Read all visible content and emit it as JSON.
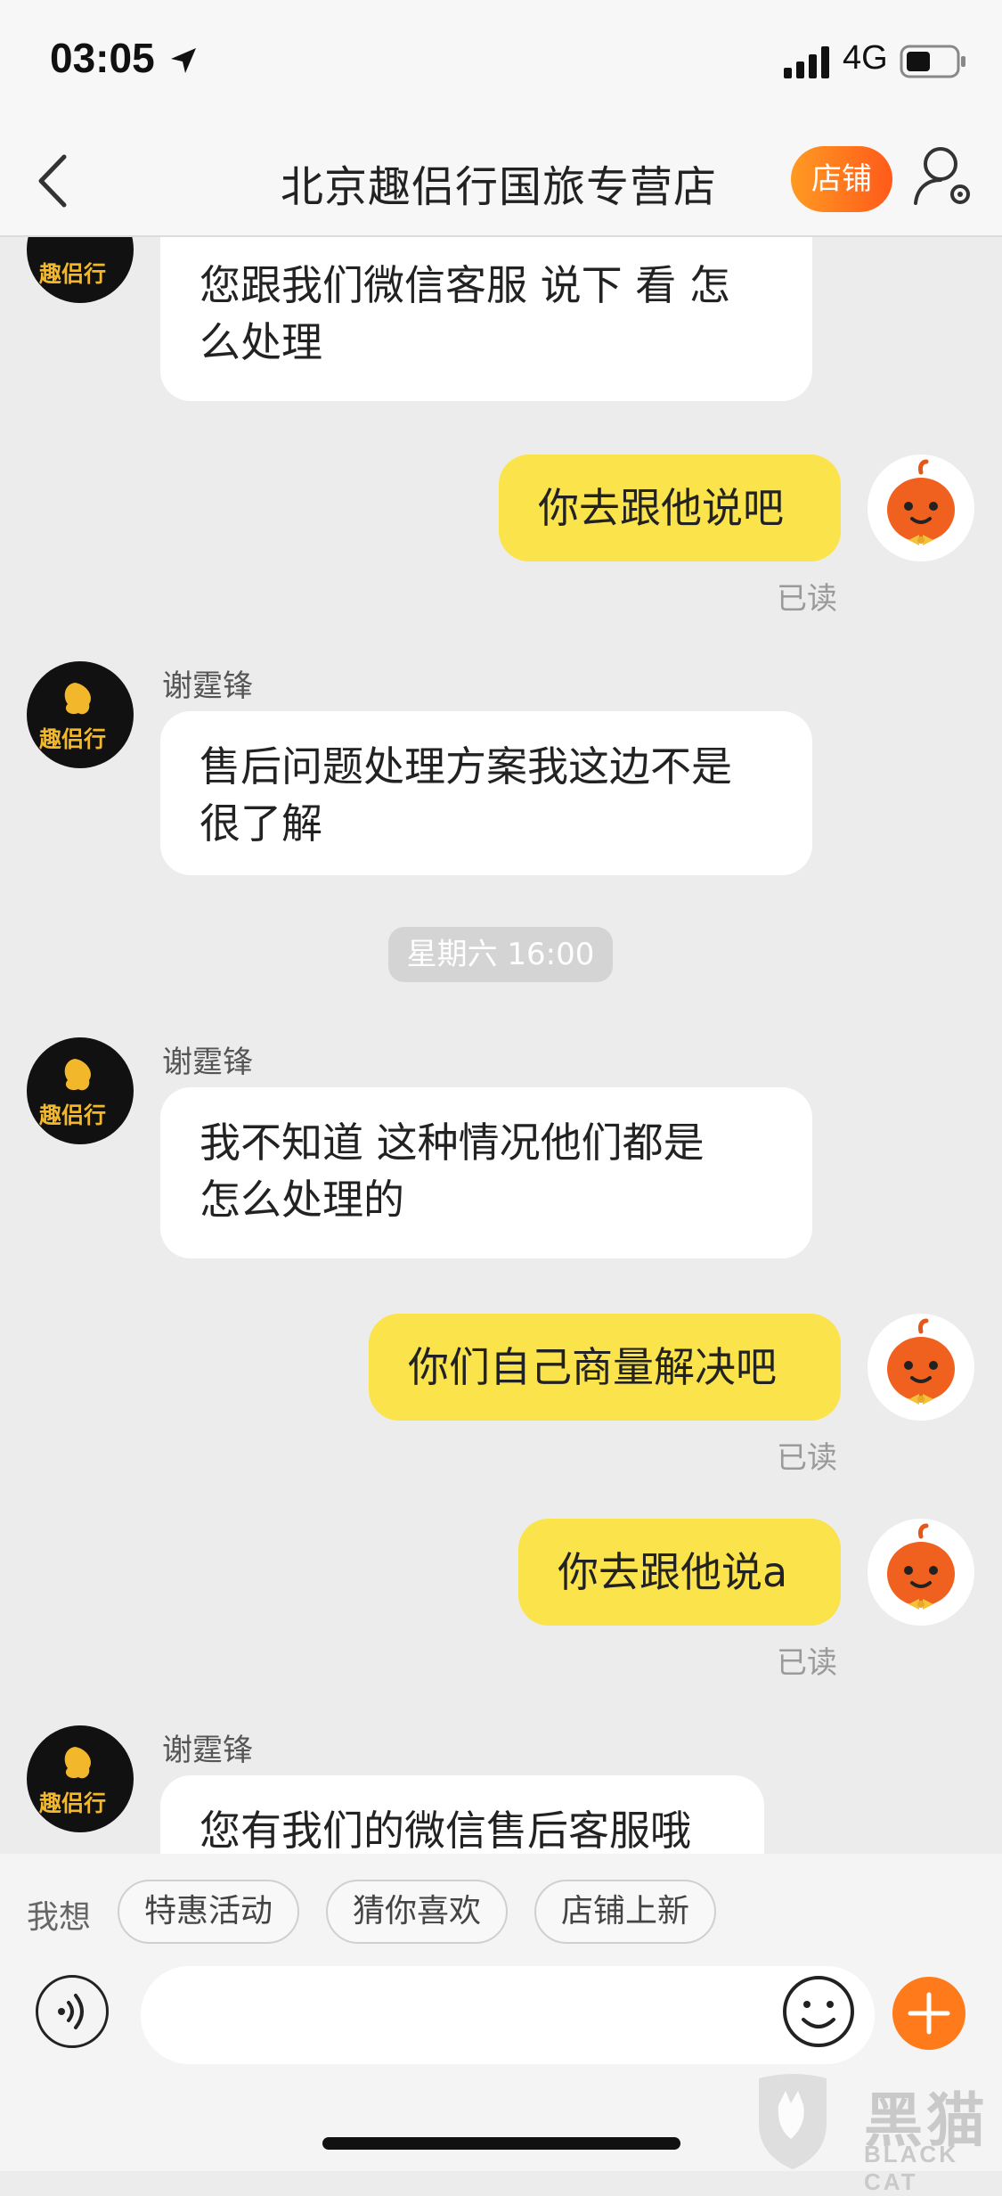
{
  "status": {
    "time": "03:05",
    "network": "4G"
  },
  "nav": {
    "title": "北京趣侣行国旅专营店",
    "shop_button": "店铺"
  },
  "shop_logo_text": "趣侣行",
  "messages": [
    {
      "side": "left",
      "text_lines": [
        "您跟我们微信客服 说下 看 怎",
        "么处理"
      ]
    },
    {
      "side": "right",
      "text": "你去跟他说吧",
      "status": "已读"
    },
    {
      "side": "left",
      "sender": "谢霆锋",
      "text_lines": [
        "售后问题处理方案我这边不是",
        "很了解"
      ]
    },
    {
      "side": "time",
      "text": "星期六 16:00"
    },
    {
      "side": "left",
      "sender": "谢霆锋",
      "text_lines": [
        "我不知道 这种情况他们都是",
        "怎么处理的"
      ]
    },
    {
      "side": "right",
      "text": "你们自己商量解决吧",
      "status": "已读"
    },
    {
      "side": "right",
      "text": "你去跟他说a",
      "status": "已读"
    },
    {
      "side": "left",
      "sender": "谢霆锋",
      "text_lines": [
        "您有我们的微信售后客服哦"
      ]
    }
  ],
  "suggestions": {
    "label": "我想",
    "chips": [
      "特惠活动",
      "猜你喜欢",
      "店铺上新"
    ]
  },
  "input": {
    "placeholder": ""
  },
  "watermark": {
    "main": "黑猫",
    "sub": "BLACK CAT"
  },
  "colors": {
    "accent": "#ff7a1a",
    "my_bubble": "#fbe34b",
    "their_bubble": "#ffffff",
    "background": "#ececec"
  },
  "icons": [
    "location-arrow-icon",
    "signal-icon",
    "battery-icon",
    "back-chevron-icon",
    "user-settings-icon",
    "voice-icon",
    "emoji-icon",
    "plus-icon",
    "pumpkin-avatar-icon",
    "shop-logo-icon"
  ]
}
